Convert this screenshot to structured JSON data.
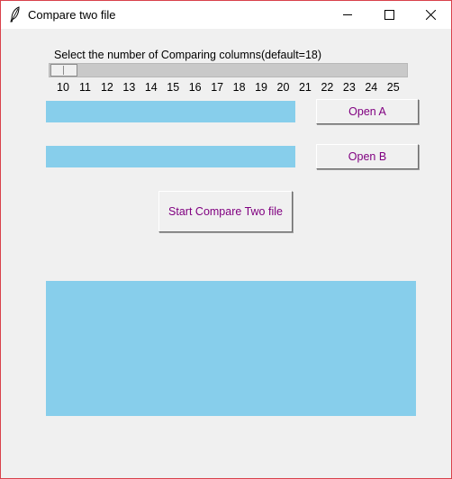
{
  "window": {
    "title": "Compare two file",
    "icon": "feather-icon",
    "border_color": "#d9414b"
  },
  "title_controls": {
    "minimize_icon": "minimize-icon",
    "maximize_icon": "maximize-icon",
    "close_icon": "close-icon"
  },
  "slider": {
    "label": "Select the number of Comparing columns(default=18)",
    "min": 10,
    "max": 25,
    "value": 10,
    "ticks": [
      "10",
      "11",
      "12",
      "13",
      "14",
      "15",
      "16",
      "17",
      "18",
      "19",
      "20",
      "21",
      "22",
      "23",
      "24",
      "25"
    ]
  },
  "file_a": {
    "value": "",
    "button_label": "Open A"
  },
  "file_b": {
    "value": "",
    "button_label": "Open B"
  },
  "start_button_label": "Start Compare Two file",
  "output": {
    "value": ""
  },
  "colors": {
    "field_background": "#87ceeb",
    "button_text": "#800080",
    "window_background": "#f0f0f0"
  }
}
